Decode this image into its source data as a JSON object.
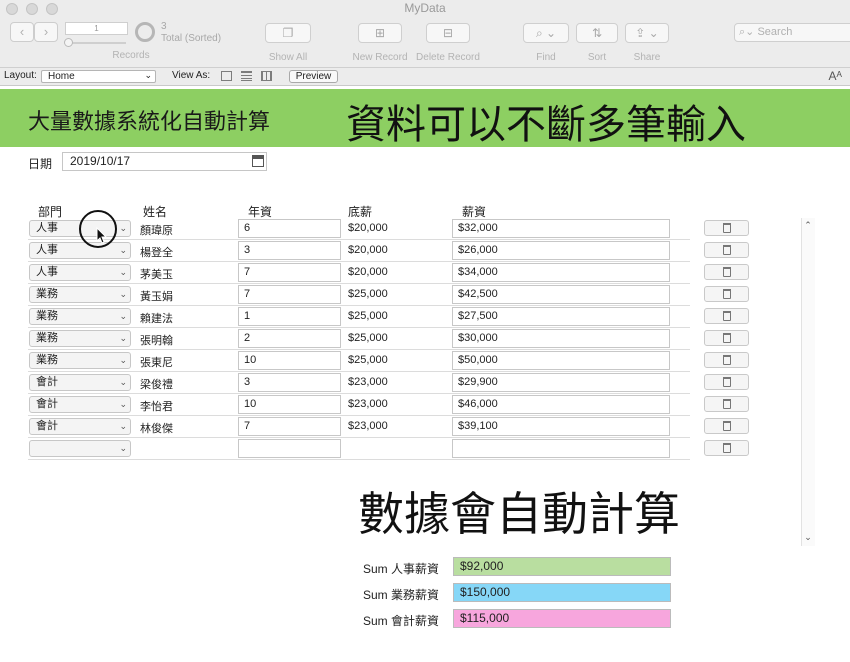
{
  "window": {
    "title": "MyData"
  },
  "toolbar": {
    "record_current": "1",
    "record_count": "3",
    "record_status": "Total (Sorted)",
    "records_label": "Records",
    "show_all_label": "Show All",
    "new_record_label": "New Record",
    "delete_record_label": "Delete Record",
    "find_label": "Find",
    "sort_label": "Sort",
    "share_label": "Share",
    "search_placeholder": "Search"
  },
  "layoutbar": {
    "layout_label": "Layout:",
    "layout_value": "Home",
    "view_as_label": "View As:",
    "preview_label": "Preview"
  },
  "banner": {
    "left_text": "大量數據系統化自動計算",
    "right_text": "資料可以不斷多筆輸入"
  },
  "date": {
    "label": "日期",
    "value": "2019/10/17"
  },
  "table": {
    "headers": {
      "dept": "部門",
      "name": "姓名",
      "years": "年資",
      "base": "底薪",
      "salary": "薪資"
    },
    "rows": [
      {
        "dept": "人事",
        "name": "顏瑋原",
        "years": "6",
        "base": "$20,000",
        "salary": "$32,000"
      },
      {
        "dept": "人事",
        "name": "楊登全",
        "years": "3",
        "base": "$20,000",
        "salary": "$26,000"
      },
      {
        "dept": "人事",
        "name": "茅美玉",
        "years": "7",
        "base": "$20,000",
        "salary": "$34,000"
      },
      {
        "dept": "業務",
        "name": "黃玉娟",
        "years": "7",
        "base": "$25,000",
        "salary": "$42,500"
      },
      {
        "dept": "業務",
        "name": "賴建法",
        "years": "1",
        "base": "$25,000",
        "salary": "$27,500"
      },
      {
        "dept": "業務",
        "name": "張明翰",
        "years": "2",
        "base": "$25,000",
        "salary": "$30,000"
      },
      {
        "dept": "業務",
        "name": "張東尼",
        "years": "10",
        "base": "$25,000",
        "salary": "$50,000"
      },
      {
        "dept": "會計",
        "name": "梁俊禮",
        "years": "3",
        "base": "$23,000",
        "salary": "$29,900"
      },
      {
        "dept": "會計",
        "name": "李怡君",
        "years": "10",
        "base": "$23,000",
        "salary": "$46,000"
      },
      {
        "dept": "會計",
        "name": "林俊傑",
        "years": "7",
        "base": "$23,000",
        "salary": "$39,100"
      },
      {
        "dept": "",
        "name": "",
        "years": "",
        "base": "",
        "salary": ""
      }
    ]
  },
  "overlay": {
    "auto_calc_text": "數據會自動計算"
  },
  "sums": [
    {
      "label": "Sum 人事薪資",
      "value": "$92,000",
      "color": "#b9dea0"
    },
    {
      "label": "Sum 業務薪資",
      "value": "$150,000",
      "color": "#86d7f7"
    },
    {
      "label": "Sum 會計薪資",
      "value": "$115,000",
      "color": "#f7a6dd"
    }
  ]
}
